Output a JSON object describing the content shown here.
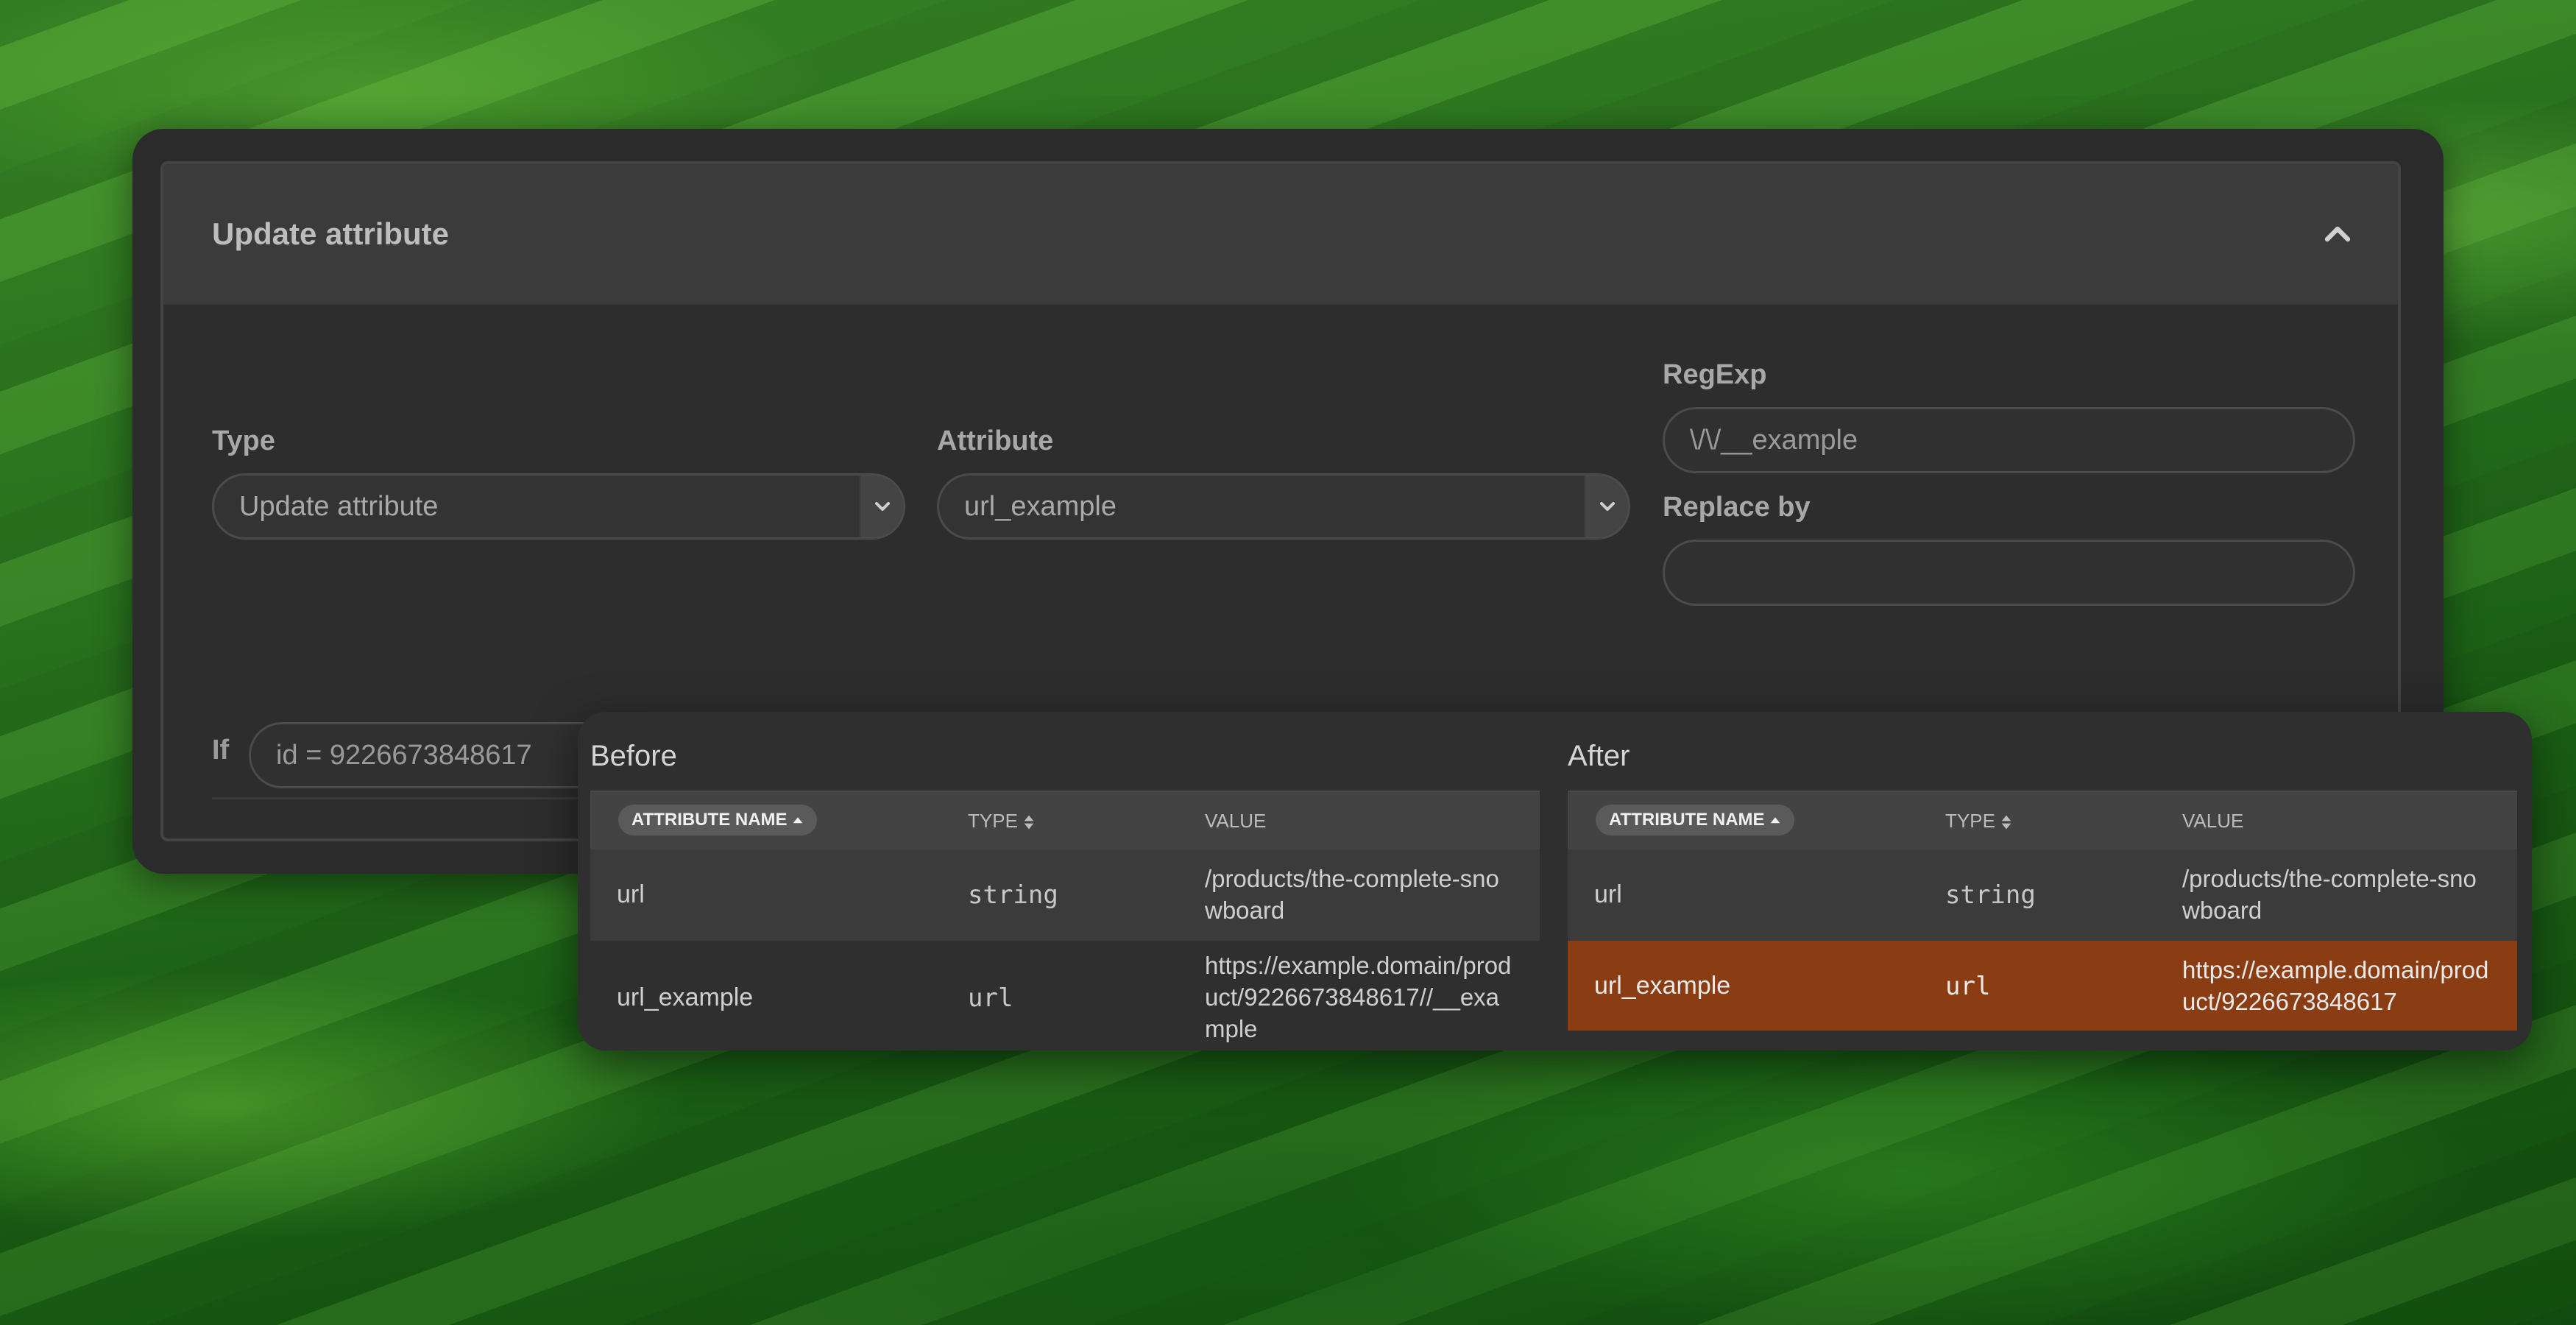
{
  "form": {
    "header_title": "Update attribute",
    "type_label": "Type",
    "type_value": "Update attribute",
    "attribute_label": "Attribute",
    "attribute_value": "url_example",
    "regexp_label": "RegExp",
    "regexp_value": "\\/\\/__example",
    "replace_label": "Replace by",
    "replace_value": "",
    "if_label": "If",
    "if_value": "id = 9226673848617"
  },
  "preview": {
    "before": {
      "title": "Before",
      "columns": [
        "ATTRIBUTE NAME",
        "TYPE",
        "VALUE"
      ],
      "rows": [
        {
          "name": "url",
          "type": "string",
          "value": "/products/the-complete-snowboard"
        },
        {
          "name": "url_example",
          "type": "url",
          "value": "https://example.domain/product/9226673848617//__example"
        }
      ]
    },
    "after": {
      "title": "After",
      "columns": [
        "ATTRIBUTE NAME",
        "TYPE",
        "VALUE"
      ],
      "rows": [
        {
          "name": "url",
          "type": "string",
          "value": "/products/the-complete-snowboard"
        },
        {
          "name": "url_example",
          "type": "url",
          "value": "https://example.domain/product/9226673848617"
        }
      ]
    }
  },
  "colors": {
    "panel_bg": "#2b2b2b",
    "header_bg": "#3b3b3b",
    "highlight_row": "#8a3c12"
  },
  "icons": [
    "chevron-up-icon",
    "chevron-down-icon",
    "sort-asc-icon",
    "sort-both-icon"
  ]
}
